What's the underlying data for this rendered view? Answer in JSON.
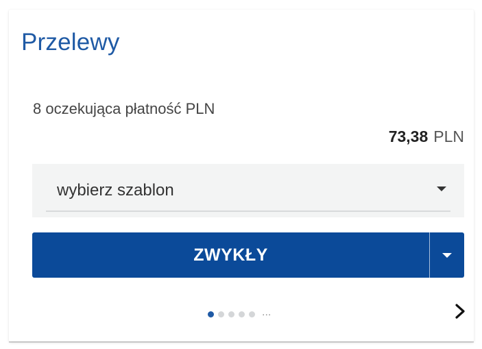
{
  "widget": {
    "title": "Przelewy",
    "pending_text": "8 oczekująca płatność PLN",
    "amount": {
      "value": "73,38",
      "currency": "PLN"
    },
    "template_select": {
      "value": "wybierz szablon",
      "icon": "caret-down-icon"
    },
    "transfer_button": {
      "label": "ZWYKŁY",
      "dropdown_icon": "caret-down-icon"
    },
    "pagination": {
      "pages": 5,
      "active_index": 0,
      "more": "...",
      "next_icon": "chevron-right-icon"
    }
  },
  "colors": {
    "title": "#1f5aa5",
    "button_bg": "#0b4a99",
    "active_dot": "#1f5aa5",
    "inactive_dot": "#d4d6d8",
    "select_bg": "#f3f4f4"
  }
}
